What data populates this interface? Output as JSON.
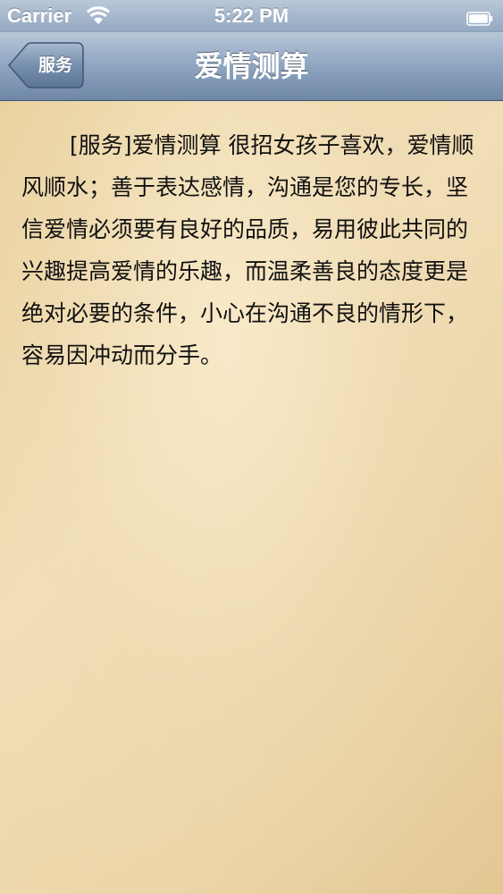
{
  "status_bar": {
    "carrier": "Carrier",
    "time": "5:22 PM",
    "wifi_icon": "wifi-icon",
    "battery_icon": "battery-icon",
    "battery_level": 1.0
  },
  "nav": {
    "back_label": "服务",
    "title": "爱情测算"
  },
  "content": {
    "text": "[服务]爱情测算 很招女孩子喜欢，爱情顺风顺水；善于表达感情，沟通是您的专长，坚信爱情必须要有良好的品质，易用彼此共同的兴趣提高爱情的乐趣，而温柔善良的态度更是绝对必要的条件，小心在沟通不良的情形下，容易因冲动而分手。"
  },
  "colors": {
    "nav_bar": "#8ea5c0",
    "paper_background": "#ecd9ad",
    "text": "#111111"
  }
}
